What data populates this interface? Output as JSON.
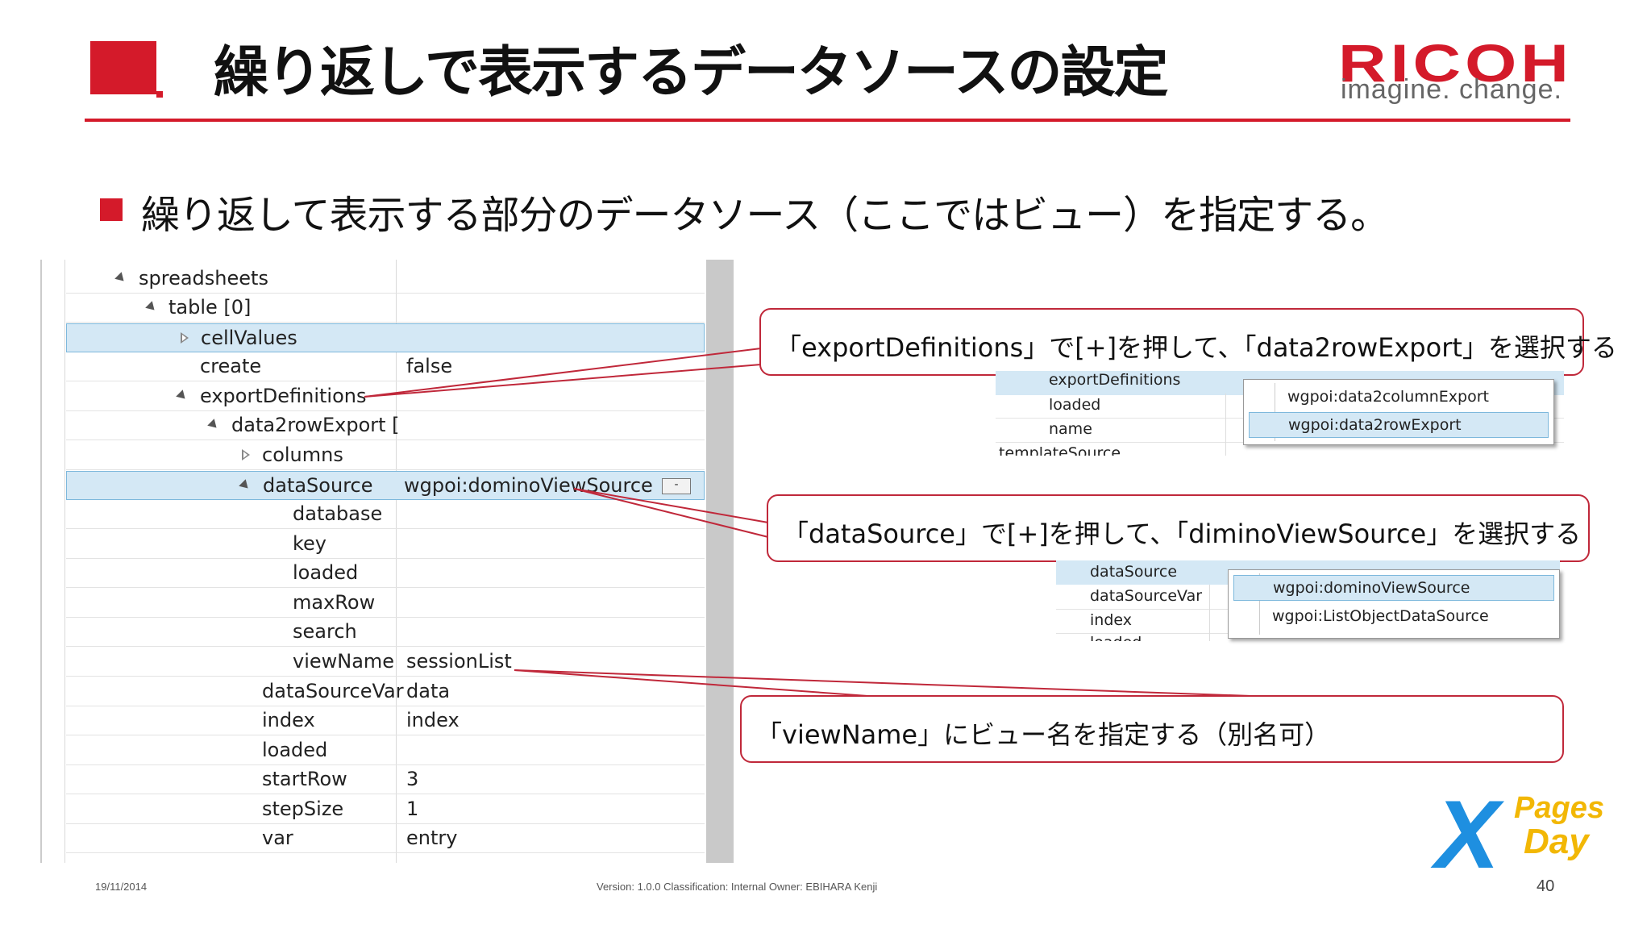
{
  "header": {
    "title": "繰り返しで表示するデータソースの設定",
    "logo_name": "RICOH",
    "logo_tagline": "imagine. change."
  },
  "bullet": {
    "text": "繰り返して表示する部分のデータソース（ここではビュー）を指定する。"
  },
  "properties": {
    "rows": [
      {
        "name": "spreadsheets",
        "value": ""
      },
      {
        "name": "table [0]",
        "value": ""
      },
      {
        "name": "cellValues",
        "value": ""
      },
      {
        "name": "create",
        "value": "false"
      },
      {
        "name": "exportDefinitions",
        "value": ""
      },
      {
        "name": "data2rowExport [",
        "value": ""
      },
      {
        "name": "columns",
        "value": ""
      },
      {
        "name": "dataSource",
        "value": "wgpoi:dominoViewSource"
      },
      {
        "name": "database",
        "value": ""
      },
      {
        "name": "key",
        "value": ""
      },
      {
        "name": "loaded",
        "value": ""
      },
      {
        "name": "maxRow",
        "value": ""
      },
      {
        "name": "search",
        "value": ""
      },
      {
        "name": "viewName",
        "value": "sessionList"
      },
      {
        "name": "dataSourceVar",
        "value": "data"
      },
      {
        "name": "index",
        "value": "index"
      },
      {
        "name": "loaded",
        "value": ""
      },
      {
        "name": "startRow",
        "value": "3"
      },
      {
        "name": "stepSize",
        "value": "1"
      },
      {
        "name": "var",
        "value": "entry"
      }
    ],
    "datasource_button": "-"
  },
  "callouts": {
    "export": "「exportDefinitions」で[+]を押して、「data2rowExport」を選択する",
    "datasource": "「dataSource」で[+]を押して、「diminoViewSource」を選択する",
    "viewname": "「viewName」にビュー名を指定する（別名可）"
  },
  "snippet_export": {
    "rows": [
      "exportDefinitions",
      "loaded",
      "name",
      "templateSource"
    ],
    "popup": [
      "wgpoi:data2columnExport",
      "wgpoi:data2rowExport"
    ]
  },
  "snippet_datasource": {
    "rows": [
      "dataSource",
      "dataSourceVar",
      "index",
      "loaded"
    ],
    "popup": [
      "wgpoi:dominoViewSource",
      "wgpoi:ListObjectDataSource"
    ]
  },
  "footer": {
    "date": "19/11/2014",
    "meta": "Version: 1.0.0 Classification: Internal  Owner: EBIHARA Kenji",
    "page": "40"
  },
  "event_logo": {
    "x": "X",
    "pages": "Pages",
    "day": "Day"
  }
}
